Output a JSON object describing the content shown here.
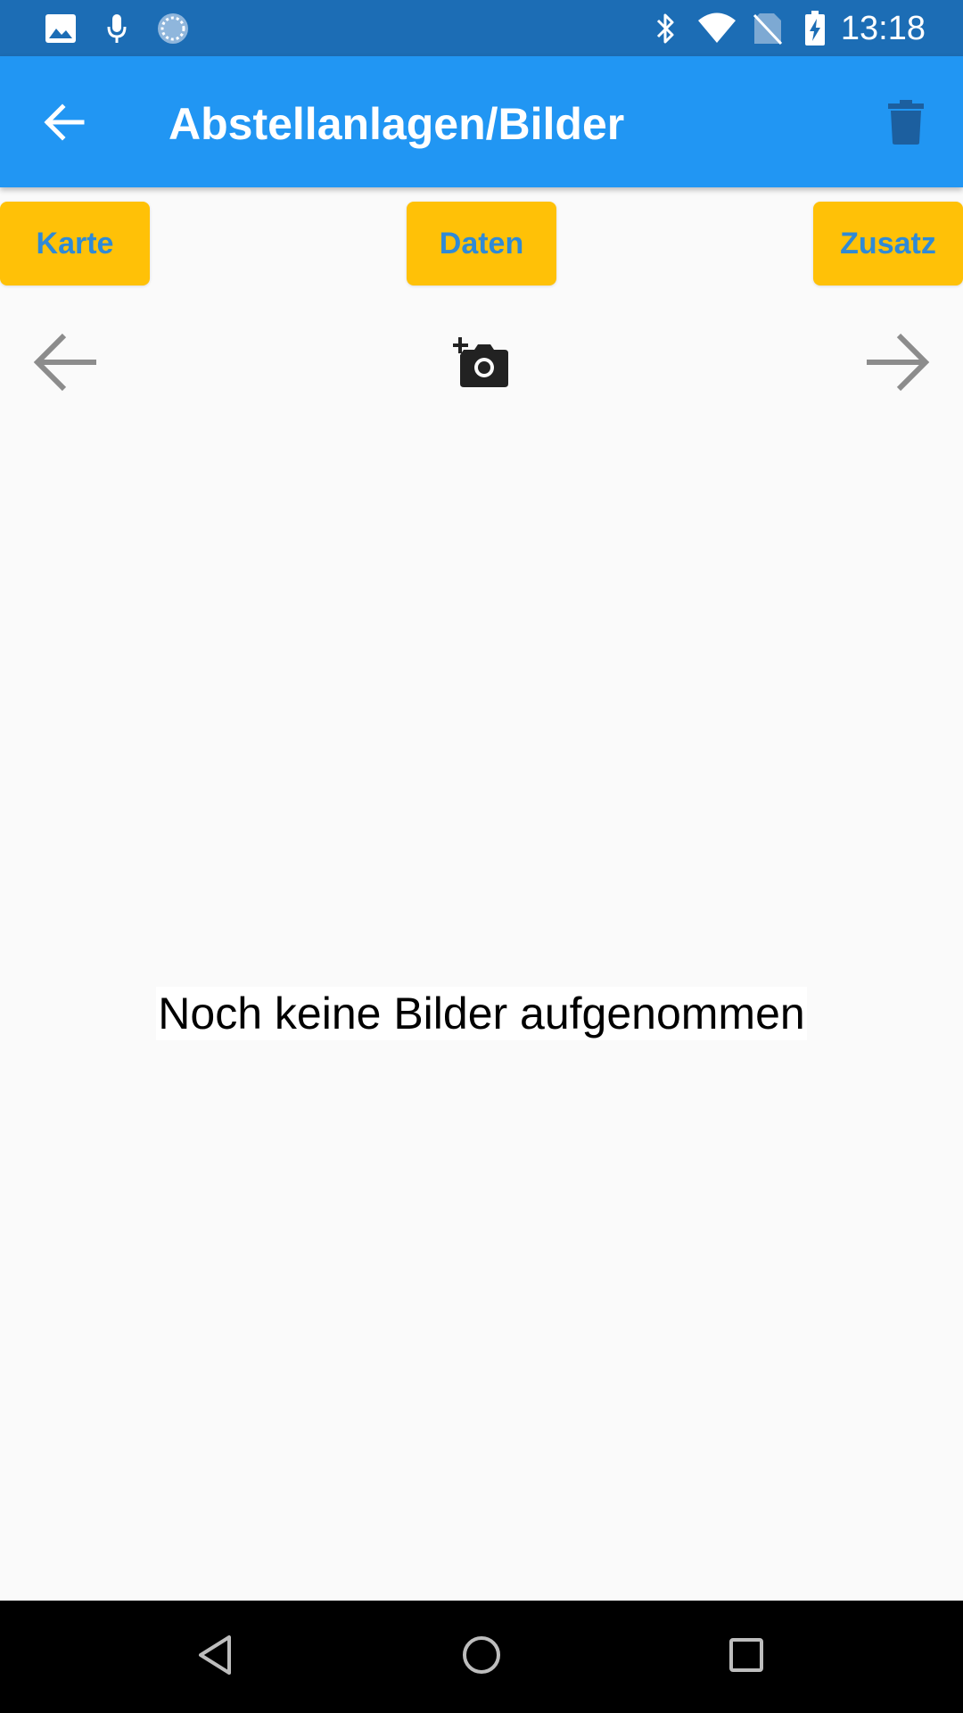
{
  "status_bar": {
    "time": "13:18",
    "icons": [
      "image-icon",
      "mic-icon",
      "sync-icon",
      "bluetooth-icon",
      "wifi-icon",
      "no-sim-icon",
      "battery-charging-icon"
    ]
  },
  "app_bar": {
    "title": "Abstellanlagen/Bilder",
    "back_icon": "arrow-back-icon",
    "delete_icon": "trash-icon"
  },
  "tabs": [
    {
      "label": "Karte"
    },
    {
      "label": "Daten"
    },
    {
      "label": "Zusatz"
    }
  ],
  "gallery": {
    "prev_icon": "arrow-left-icon",
    "next_icon": "arrow-right-icon",
    "add_photo_icon": "add-a-photo-icon",
    "empty_message": "Noch keine Bilder aufgenommen"
  },
  "nav_bar": {
    "icons": [
      "nav-back-icon",
      "nav-home-icon",
      "nav-recents-icon"
    ]
  },
  "colors": {
    "status_bar": "#1c6db5",
    "app_bar": "#2196f3",
    "tab_button": "#ffc107",
    "tab_text": "#2f8ad6",
    "background": "#fafafa"
  }
}
